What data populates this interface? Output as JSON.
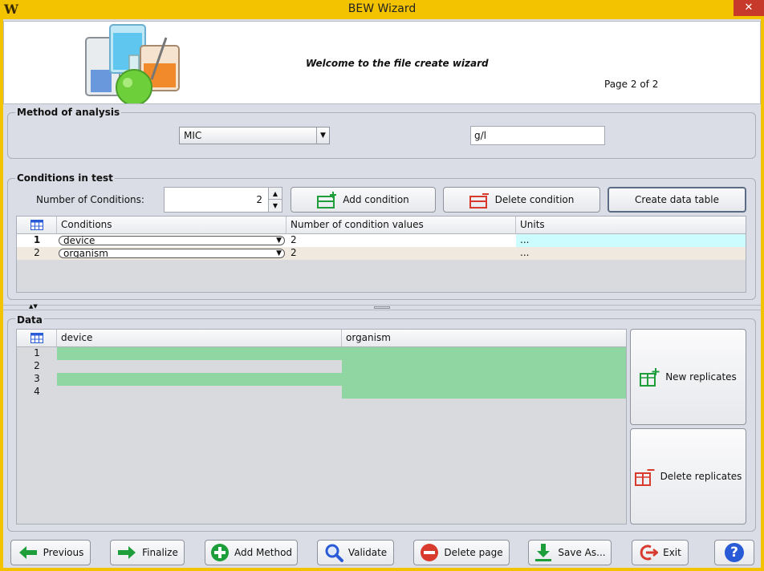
{
  "window": {
    "title": "BEW Wizard",
    "app_icon": "W",
    "close_glyph": "✕"
  },
  "banner": {
    "title": "Welcome to the file create wizard",
    "page_indicator": "Page 2 of 2"
  },
  "method": {
    "group_title": "Method of analysis",
    "selected": "MIC",
    "unit_value": "g/l"
  },
  "conditions": {
    "group_title": "Conditions in test",
    "count_label": "Number of Conditions:",
    "count_value": "2",
    "add_label": "Add condition",
    "delete_label": "Delete condition",
    "create_label": "Create data table",
    "columns": [
      "Conditions",
      "Number of condition values",
      "Units"
    ],
    "rows": [
      {
        "index": "1",
        "condition": "device",
        "values": "2",
        "units": "..."
      },
      {
        "index": "2",
        "condition": "organism",
        "values": "2",
        "units": "..."
      }
    ]
  },
  "data": {
    "group_title": "Data",
    "columns": [
      "device",
      "organism"
    ],
    "rows": [
      "1",
      "2",
      "3",
      "4"
    ],
    "new_replicates_label": "New replicates",
    "delete_replicates_label": "Delete replicates"
  },
  "footer": {
    "previous": "Previous",
    "finalize": "Finalize",
    "add_method": "Add Method",
    "validate": "Validate",
    "delete_page": "Delete page",
    "save_as": "Save As...",
    "exit": "Exit",
    "help": "?"
  },
  "colors": {
    "title_bar": "#f3c300",
    "panel": "#dadde5",
    "filled_cell": "#8fd6a3",
    "empty_cell": "#d9dadd",
    "selected_units": "#ccfcfe",
    "row_alt": "#efe9e0",
    "green_icon": "#1e9e3a",
    "red_icon": "#d93a2e",
    "blue_icon": "#2a5bd7"
  }
}
